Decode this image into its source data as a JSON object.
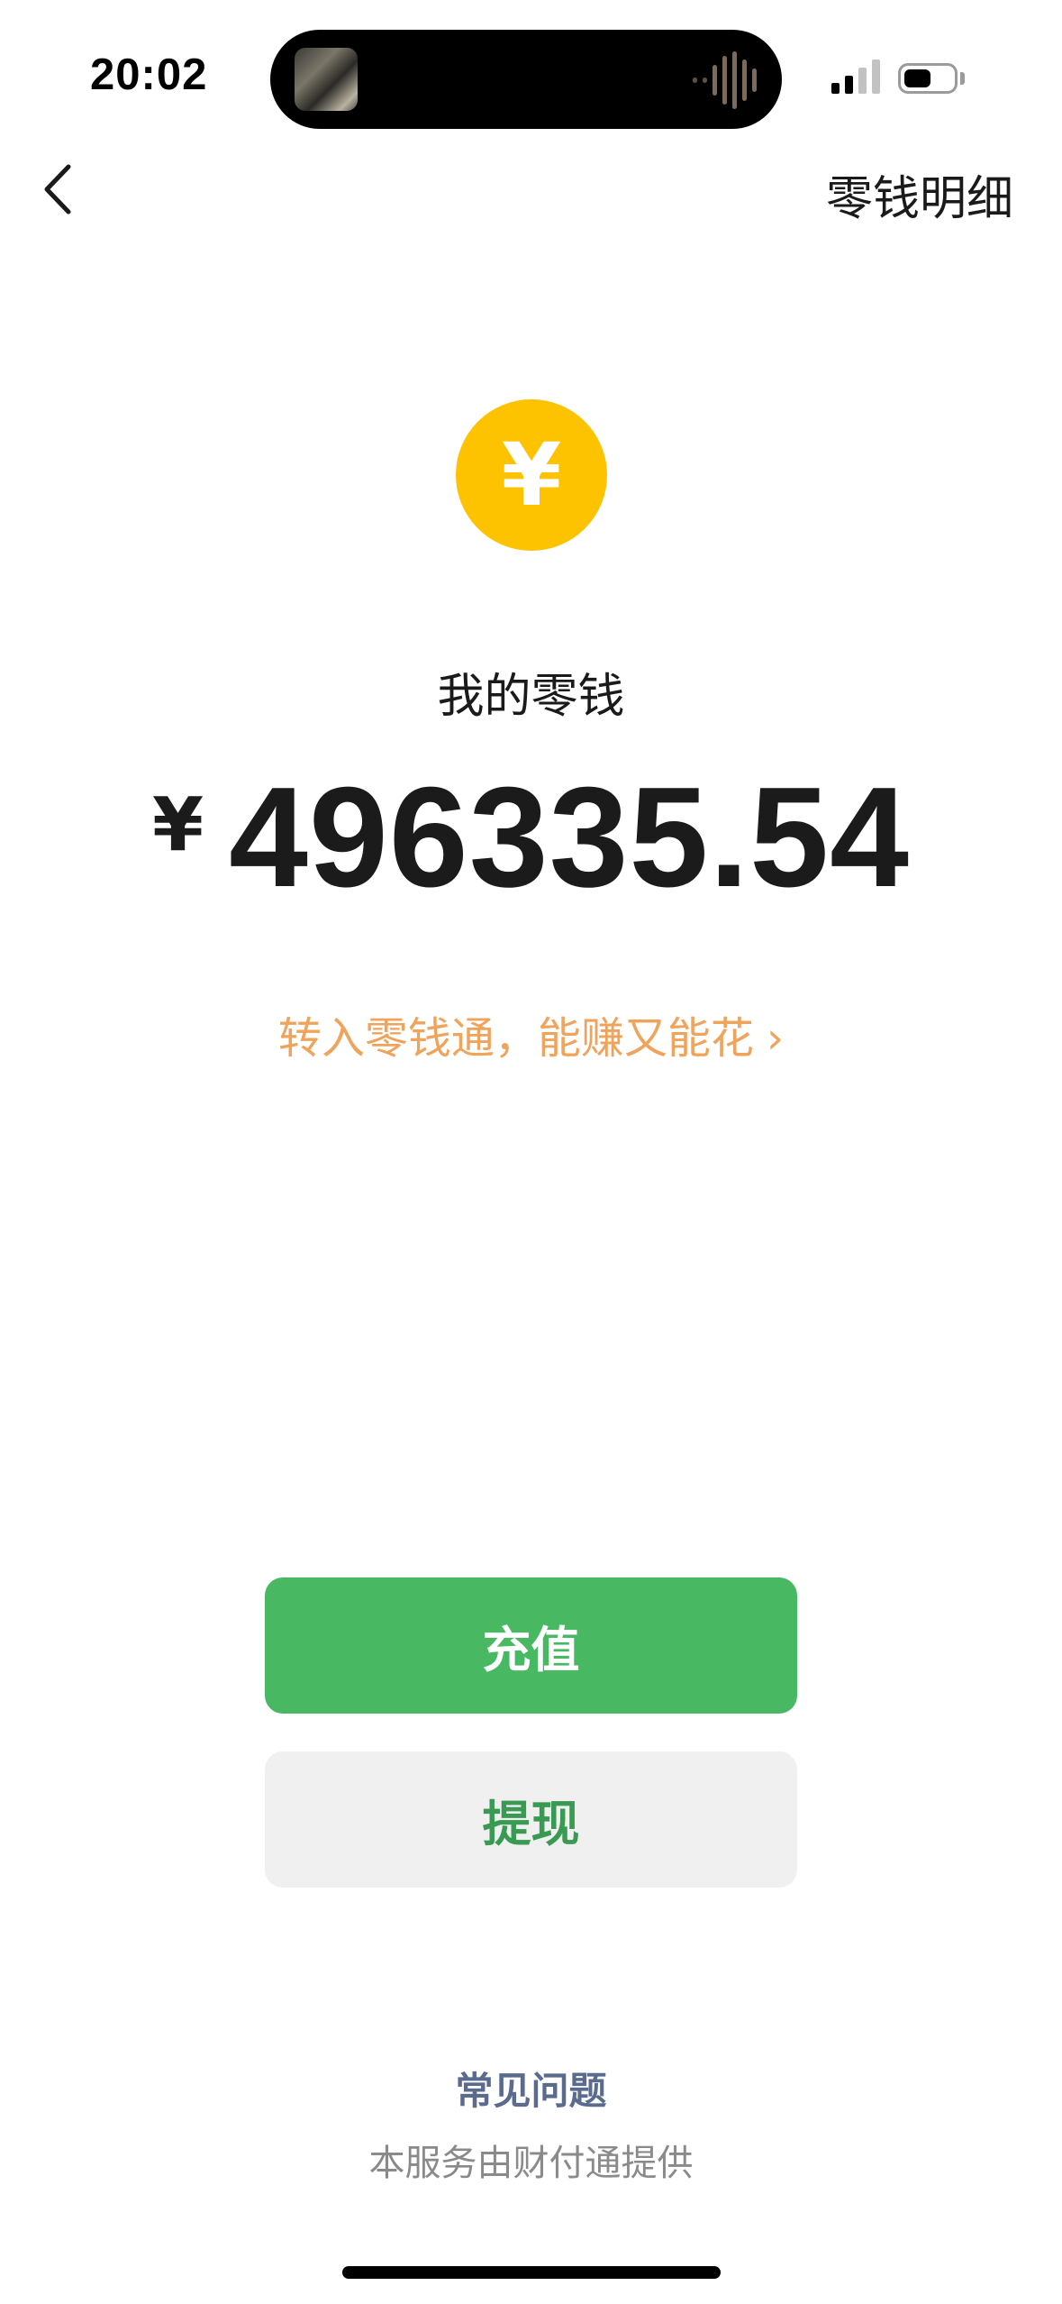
{
  "status_bar": {
    "time": "20:02"
  },
  "nav": {
    "title_right": "零钱明细"
  },
  "wallet": {
    "coin_symbol": "¥",
    "title": "我的零钱",
    "currency": "¥",
    "amount": "496335.54",
    "promo": "转入零钱通，能赚又能花",
    "promo_chevron": "›"
  },
  "actions": {
    "topup_label": "充值",
    "withdraw_label": "提现"
  },
  "footer": {
    "faq": "常见问题",
    "provider": "本服务由财付通提供"
  },
  "colors": {
    "coin": "#fdc300",
    "primary_green": "#48b863",
    "promo_orange": "#f0a35b",
    "link_blue": "#5a6b8e"
  }
}
